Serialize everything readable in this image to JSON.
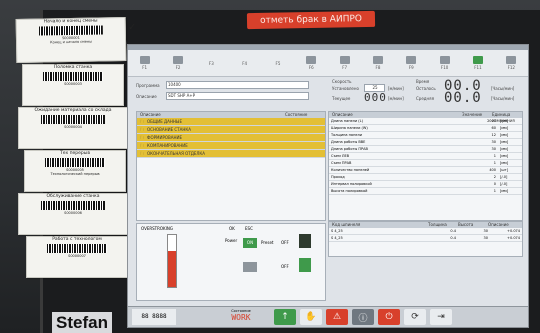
{
  "sticker": {
    "text": "отметь брак в АИПРО"
  },
  "brand": {
    "text": "Stefan"
  },
  "notes": [
    {
      "title": "Начало и конец смены",
      "code": "S0000001",
      "sub": "Конец и начало смены"
    },
    {
      "title": "Поломка станка",
      "code": "S0000003",
      "sub": ""
    },
    {
      "title": "Ожидание материала со склада",
      "code": "S0000004",
      "sub": ""
    },
    {
      "title": "Тех перерыв",
      "code": "S0000005",
      "sub": "Технологический перерыв"
    },
    {
      "title": "Обслуживание станка",
      "code": "S0000006",
      "sub": ""
    },
    {
      "title": "Работа с технологом",
      "code": "S0000007",
      "sub": ""
    }
  ],
  "toolbar": {
    "keys": [
      "F1",
      "F2",
      "F3",
      "F4",
      "F5",
      "F6",
      "F7",
      "F8",
      "F9",
      "F10",
      "F11",
      "F12"
    ]
  },
  "info": {
    "order_label": "Программа",
    "order_value": "10400",
    "desc_label": "Описание",
    "desc_value": "SDT SHP A+P",
    "speed_label": "Скорость",
    "set_label": "Установлено",
    "set_value": "25",
    "current_label": "Текущее",
    "current_display": "000",
    "unit": "[м/мин]",
    "time_label": "Время",
    "remain_label": "Осталось",
    "remain_display": "00.0",
    "mid_label": "Средняя",
    "mid_display": "00.0",
    "time_unit": "[Часы/мин]"
  },
  "ops": {
    "header": [
      "Описание",
      "Состояние"
    ],
    "rows": [
      "ОБЩИЕ ДАННЫЕ",
      "ОСНОВАНИЕ СТАНКА",
      "ФОРМИРОВАНИЕ",
      "КОМПАНИРОВАНИЕ",
      "ОКОНЧАТЕЛЬНАЯ ОТДЕЛКА"
    ]
  },
  "params": {
    "header": [
      "Описание",
      "Значение",
      "Единица измерения"
    ],
    "rows": [
      [
        "Длина панели (L)",
        "2000",
        "[мм]"
      ],
      [
        "Ширина панели (W)",
        "60",
        "[мм]"
      ],
      [
        "Толщина панели",
        "12",
        "[мм]"
      ],
      [
        "Длина работы ВВЕ",
        "30",
        "[мм]"
      ],
      [
        "Длина работы ПРАВ",
        "30",
        "[мм]"
      ],
      [
        "Съем ЛЕВ",
        "1",
        "[мм]"
      ],
      [
        "Съем ПРАВ",
        "1",
        "[мм]"
      ],
      [
        "Количество панелей",
        "400",
        "[шт]"
      ],
      [
        "Проход",
        "2",
        "[/-0]"
      ],
      [
        "Интервал полировкой",
        "0",
        "[/-0]"
      ],
      [
        "Высота полировкой",
        "1",
        "[мм]"
      ]
    ]
  },
  "lower_table": {
    "header": [
      "Код шпинеля",
      "Толщина",
      "Высота",
      "Описание"
    ],
    "rows": [
      [
        "S 4_25",
        "0.4",
        "30",
        "+0.074"
      ],
      [
        "S 4_25",
        "0.4",
        "30",
        "+0.074"
      ]
    ]
  },
  "controls": {
    "gauge_label": "OVERSTROKING",
    "power_label": "Power",
    "preset_label": "Preset",
    "off_label": "OFF",
    "on_label": "ON",
    "status_label": "Состояние",
    "status_display": "WORK",
    "ok": "OK",
    "esc": "ESC"
  },
  "colors": {
    "accent": "#e3bf35",
    "alarm": "#d8402b",
    "ok": "#3f9a4b"
  }
}
